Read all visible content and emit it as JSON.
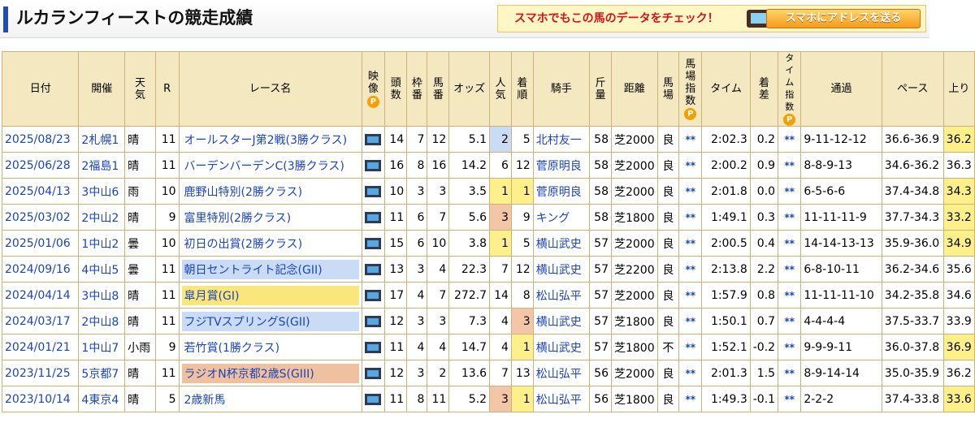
{
  "header": {
    "title": "ルカランフィーストの競走成績",
    "promo_text": "スマホでもこの馬のデータをチェック！",
    "promo_button": "スマホにアドレスを送る"
  },
  "columns": {
    "date": "日付",
    "venue": "開催",
    "weather": "天気",
    "r": "R",
    "race": "レース名",
    "video": "映像",
    "heads": "頭数",
    "gate": "枠番",
    "horse_no": "馬番",
    "odds": "オッズ",
    "pop": "人気",
    "finish": "着順",
    "jockey": "騎手",
    "weight": "斤量",
    "dist": "距離",
    "track": "馬場",
    "track_index": "馬場指数",
    "time": "タイム",
    "margin": "着差",
    "time_index": "タイム指数",
    "passing": "通過",
    "pace": "ペース",
    "last": "上り",
    "p_mark": "P"
  },
  "rows": [
    {
      "date": "2025/08/23",
      "venue": "2札幌1",
      "weather": "晴",
      "r": "11",
      "race": "オールスターJ第2戦(3勝クラス)",
      "race_grade": "",
      "heads": "14",
      "gate": "7",
      "horse_no": "12",
      "odds": "5.1",
      "pop": "2",
      "pop_hl": "b",
      "finish": "5",
      "finish_hl": "",
      "jockey": "北村友一",
      "weight": "58",
      "dist": "芝2000",
      "track": "良",
      "track_index": "**",
      "time": "2:02.3",
      "margin": "0.2",
      "time_index": "**",
      "passing": "9-11-12-12",
      "pace": "36.6-36.9",
      "last": "36.2",
      "last_hl": "y"
    },
    {
      "date": "2025/06/28",
      "venue": "2福島1",
      "weather": "晴",
      "r": "11",
      "race": "バーデンバーデンC(3勝クラス)",
      "race_grade": "",
      "heads": "16",
      "gate": "8",
      "horse_no": "16",
      "odds": "14.2",
      "pop": "6",
      "pop_hl": "",
      "finish": "12",
      "finish_hl": "",
      "jockey": "菅原明良",
      "weight": "58",
      "dist": "芝2000",
      "track": "良",
      "track_index": "**",
      "time": "2:00.2",
      "margin": "0.9",
      "time_index": "**",
      "passing": "8-8-9-13",
      "pace": "34.6-36.2",
      "last": "36.3",
      "last_hl": ""
    },
    {
      "date": "2025/04/13",
      "venue": "3中山6",
      "weather": "雨",
      "r": "10",
      "race": "鹿野山特別(2勝クラス)",
      "race_grade": "",
      "heads": "10",
      "gate": "3",
      "horse_no": "3",
      "odds": "3.5",
      "pop": "1",
      "pop_hl": "y",
      "finish": "1",
      "finish_hl": "y",
      "jockey": "菅原明良",
      "weight": "58",
      "dist": "芝2000",
      "track": "良",
      "track_index": "**",
      "time": "2:01.8",
      "margin": "0.0",
      "time_index": "**",
      "passing": "6-5-6-6",
      "pace": "37.4-34.8",
      "last": "34.3",
      "last_hl": "y"
    },
    {
      "date": "2025/03/02",
      "venue": "2中山2",
      "weather": "晴",
      "r": "9",
      "race": "富里特別(2勝クラス)",
      "race_grade": "",
      "heads": "11",
      "gate": "6",
      "horse_no": "7",
      "odds": "5.6",
      "pop": "3",
      "pop_hl": "o",
      "finish": "9",
      "finish_hl": "",
      "jockey": "キング",
      "weight": "58",
      "dist": "芝1800",
      "track": "良",
      "track_index": "**",
      "time": "1:49.1",
      "margin": "0.3",
      "time_index": "**",
      "passing": "11-11-11-9",
      "pace": "37.7-34.3",
      "last": "33.2",
      "last_hl": "y"
    },
    {
      "date": "2025/01/06",
      "venue": "1中山2",
      "weather": "曇",
      "r": "10",
      "race": "初日の出賞(2勝クラス)",
      "race_grade": "",
      "heads": "15",
      "gate": "6",
      "horse_no": "10",
      "odds": "3.8",
      "pop": "1",
      "pop_hl": "y",
      "finish": "5",
      "finish_hl": "",
      "jockey": "横山武史",
      "weight": "57",
      "dist": "芝2000",
      "track": "良",
      "track_index": "**",
      "time": "2:00.5",
      "margin": "0.4",
      "time_index": "**",
      "passing": "14-14-13-13",
      "pace": "35.9-36.0",
      "last": "34.9",
      "last_hl": "y"
    },
    {
      "date": "2024/09/16",
      "venue": "4中山5",
      "weather": "曇",
      "r": "11",
      "race": "朝日セントライト記念(GII)",
      "race_grade": "g2",
      "heads": "13",
      "gate": "3",
      "horse_no": "4",
      "odds": "22.3",
      "pop": "7",
      "pop_hl": "",
      "finish": "12",
      "finish_hl": "",
      "jockey": "横山武史",
      "weight": "57",
      "dist": "芝2200",
      "track": "良",
      "track_index": "**",
      "time": "2:13.8",
      "margin": "2.2",
      "time_index": "**",
      "passing": "6-8-10-11",
      "pace": "36.2-34.6",
      "last": "35.6",
      "last_hl": ""
    },
    {
      "date": "2024/04/14",
      "venue": "3中山8",
      "weather": "晴",
      "r": "11",
      "race": "皐月賞(GI)",
      "race_grade": "g1",
      "heads": "17",
      "gate": "4",
      "horse_no": "7",
      "odds": "272.7",
      "pop": "14",
      "pop_hl": "",
      "finish": "8",
      "finish_hl": "",
      "jockey": "松山弘平",
      "weight": "57",
      "dist": "芝2000",
      "track": "良",
      "track_index": "**",
      "time": "1:57.9",
      "margin": "0.8",
      "time_index": "**",
      "passing": "11-11-11-10",
      "pace": "34.2-35.8",
      "last": "34.6",
      "last_hl": ""
    },
    {
      "date": "2024/03/17",
      "venue": "2中山8",
      "weather": "晴",
      "r": "11",
      "race": "フジTVスプリングS(GII)",
      "race_grade": "g2",
      "heads": "12",
      "gate": "3",
      "horse_no": "3",
      "odds": "7.3",
      "pop": "4",
      "pop_hl": "",
      "finish": "3",
      "finish_hl": "o",
      "jockey": "横山武史",
      "weight": "57",
      "dist": "芝1800",
      "track": "良",
      "track_index": "**",
      "time": "1:50.1",
      "margin": "0.7",
      "time_index": "**",
      "passing": "4-4-4-4",
      "pace": "37.5-33.7",
      "last": "33.9",
      "last_hl": ""
    },
    {
      "date": "2024/01/21",
      "venue": "1中山7",
      "weather": "小雨",
      "r": "9",
      "race": "若竹賞(1勝クラス)",
      "race_grade": "",
      "heads": "11",
      "gate": "4",
      "horse_no": "4",
      "odds": "14.7",
      "pop": "4",
      "pop_hl": "",
      "finish": "1",
      "finish_hl": "y",
      "jockey": "横山武史",
      "weight": "57",
      "dist": "芝1800",
      "track": "不",
      "track_index": "**",
      "time": "1:52.1",
      "margin": "-0.2",
      "time_index": "**",
      "passing": "9-9-9-11",
      "pace": "36.0-37.8",
      "last": "36.9",
      "last_hl": "y"
    },
    {
      "date": "2023/11/25",
      "venue": "5京都7",
      "weather": "晴",
      "r": "11",
      "race": "ラジオN杯京都2歳S(GIII)",
      "race_grade": "g3",
      "heads": "12",
      "gate": "3",
      "horse_no": "2",
      "odds": "13.6",
      "pop": "7",
      "pop_hl": "",
      "finish": "13",
      "finish_hl": "",
      "jockey": "松山弘平",
      "weight": "56",
      "dist": "芝2000",
      "track": "良",
      "track_index": "**",
      "time": "2:01.3",
      "margin": "1.5",
      "time_index": "**",
      "passing": "8-9-14-14",
      "pace": "35.0-35.9",
      "last": "36.2",
      "last_hl": ""
    },
    {
      "date": "2023/10/14",
      "venue": "4東京4",
      "weather": "晴",
      "r": "5",
      "race": "2歳新馬",
      "race_grade": "",
      "heads": "11",
      "gate": "8",
      "horse_no": "11",
      "odds": "5.2",
      "pop": "3",
      "pop_hl": "o",
      "finish": "1",
      "finish_hl": "y",
      "jockey": "松山弘平",
      "weight": "56",
      "dist": "芝1800",
      "track": "良",
      "track_index": "**",
      "time": "1:49.3",
      "margin": "-0.1",
      "time_index": "**",
      "passing": "2-2-2",
      "pace": "37.4-33.8",
      "last": "33.6",
      "last_hl": "y"
    }
  ]
}
